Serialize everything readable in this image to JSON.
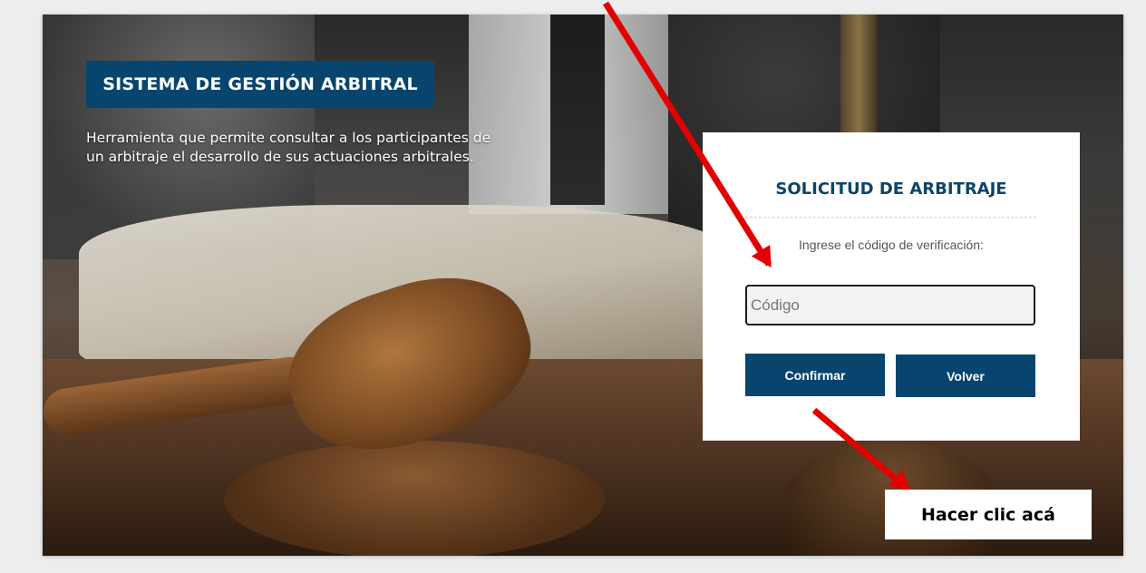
{
  "hero": {
    "badge_title": "SISTEMA DE GESTIÓN ARBITRAL",
    "intro_text": "Herramienta que permite consultar a los participantes de un arbitraje el desarrollo de sus actuaciones arbitrales."
  },
  "card": {
    "title": "SOLICITUD DE ARBITRAJE",
    "prompt": "Ingrese el código de verificación:",
    "code_placeholder": "Código",
    "code_value": "",
    "confirm_label": "Confirmar",
    "back_label": "Volver"
  },
  "annotation": {
    "callout_text": "Hacer clic acá",
    "arrow_color": "#e30000"
  },
  "colors": {
    "primary": "#07456f",
    "card_title": "#0e4469"
  }
}
